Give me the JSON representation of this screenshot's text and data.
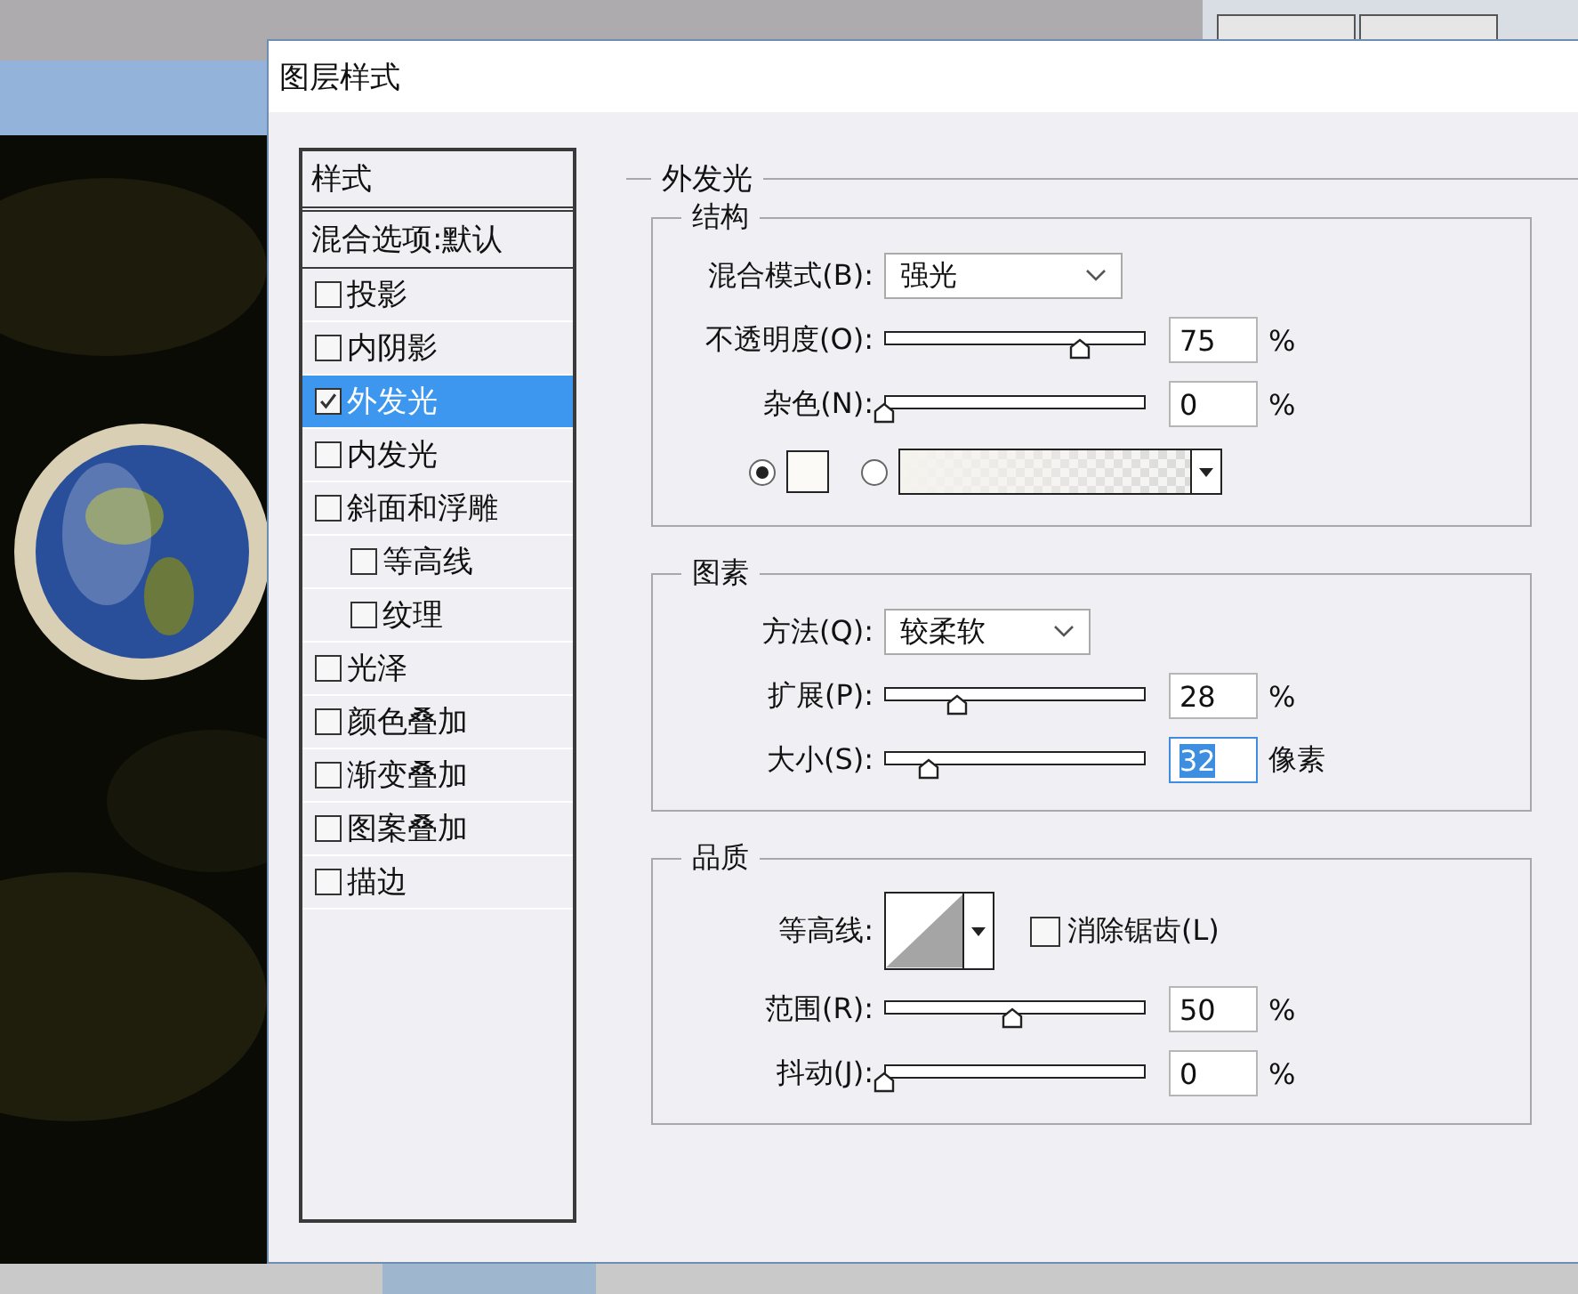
{
  "dialog": {
    "title": "图层样式"
  },
  "style_list": {
    "header": "样式",
    "blending_options": "混合选项:默认",
    "items": [
      {
        "label": "投影",
        "checked": false,
        "selected": false
      },
      {
        "label": "内阴影",
        "checked": false,
        "selected": false
      },
      {
        "label": "外发光",
        "checked": true,
        "selected": true
      },
      {
        "label": "内发光",
        "checked": false,
        "selected": false
      },
      {
        "label": "斜面和浮雕",
        "checked": false,
        "selected": false,
        "children": [
          {
            "label": "等高线",
            "checked": false,
            "selected": false
          },
          {
            "label": "纹理",
            "checked": false,
            "selected": false
          }
        ]
      },
      {
        "label": "光泽",
        "checked": false,
        "selected": false
      },
      {
        "label": "颜色叠加",
        "checked": false,
        "selected": false
      },
      {
        "label": "渐变叠加",
        "checked": false,
        "selected": false
      },
      {
        "label": "图案叠加",
        "checked": false,
        "selected": false
      },
      {
        "label": "描边",
        "checked": false,
        "selected": false
      }
    ]
  },
  "panel": {
    "title": "外发光",
    "structure": {
      "title": "结构",
      "blend_mode": {
        "label": "混合模式(B):",
        "value": "强光"
      },
      "sliders": [
        {
          "label": "不透明度(O):",
          "level": 0.75,
          "value": "75",
          "unit": "%",
          "focused": false
        },
        {
          "label": "杂色(N):",
          "level": 0,
          "value": "0",
          "unit": "%",
          "focused": false
        }
      ],
      "fill_options": [
        {
          "kind": "color",
          "selected": true
        },
        {
          "kind": "gradient",
          "selected": false
        }
      ]
    },
    "elements": {
      "title": "图素",
      "technique": {
        "label": "方法(Q):",
        "value": "较柔软"
      },
      "sliders": [
        {
          "label": "扩展(P):",
          "level": 0.28,
          "value": "28",
          "unit": "%",
          "focused": false
        },
        {
          "label": "大小(S):",
          "level": 0.17,
          "value": "32",
          "unit": "像素",
          "focused": true
        }
      ]
    },
    "quality": {
      "title": "品质",
      "contour_label": "等高线:",
      "anti_alias": {
        "label": "消除锯齿(L)",
        "checked": false
      },
      "sliders": [
        {
          "label": "范围(R):",
          "level": 0.49,
          "value": "50",
          "unit": "%",
          "focused": false
        },
        {
          "label": "抖动(J):",
          "level": 0,
          "value": "0",
          "unit": "%",
          "focused": false
        }
      ]
    }
  }
}
